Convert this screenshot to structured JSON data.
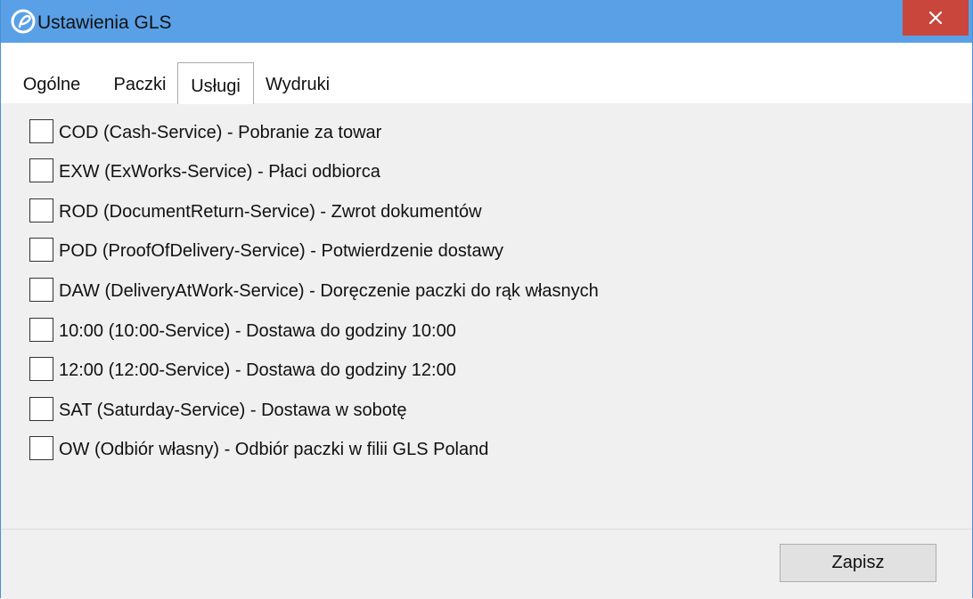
{
  "window": {
    "title": "Ustawienia GLS",
    "close_glyph": "✕"
  },
  "tabs": [
    {
      "label": "Ogólne",
      "active": false
    },
    {
      "label": "Paczki",
      "active": false
    },
    {
      "label": "Usługi",
      "active": true
    },
    {
      "label": "Wydruki",
      "active": false
    }
  ],
  "services": [
    {
      "label": "COD (Cash-Service) - Pobranie za towar",
      "checked": false
    },
    {
      "label": "EXW (ExWorks-Service) - Płaci odbiorca",
      "checked": false
    },
    {
      "label": "ROD (DocumentReturn-Service) - Zwrot dokumentów",
      "checked": false
    },
    {
      "label": "POD (ProofOfDelivery-Service) - Potwierdzenie dostawy",
      "checked": false
    },
    {
      "label": "DAW (DeliveryAtWork-Service) - Doręczenie paczki do rąk własnych",
      "checked": false
    },
    {
      "label": "10:00 (10:00-Service) - Dostawa do godziny 10:00",
      "checked": false
    },
    {
      "label": "12:00 (12:00-Service) - Dostawa do godziny 12:00",
      "checked": false
    },
    {
      "label": "SAT (Saturday-Service) - Dostawa w sobotę",
      "checked": false
    },
    {
      "label": "OW (Odbiór własny) - Odbiór paczki w filii GLS Poland",
      "checked": false
    }
  ],
  "footer": {
    "save_label": "Zapisz"
  },
  "colors": {
    "titlebar": "#5aa0e6",
    "close_button": "#c9463d",
    "background": "#f0f0f0"
  },
  "icons": {
    "app": "app-logo-icon",
    "close": "close-icon"
  }
}
